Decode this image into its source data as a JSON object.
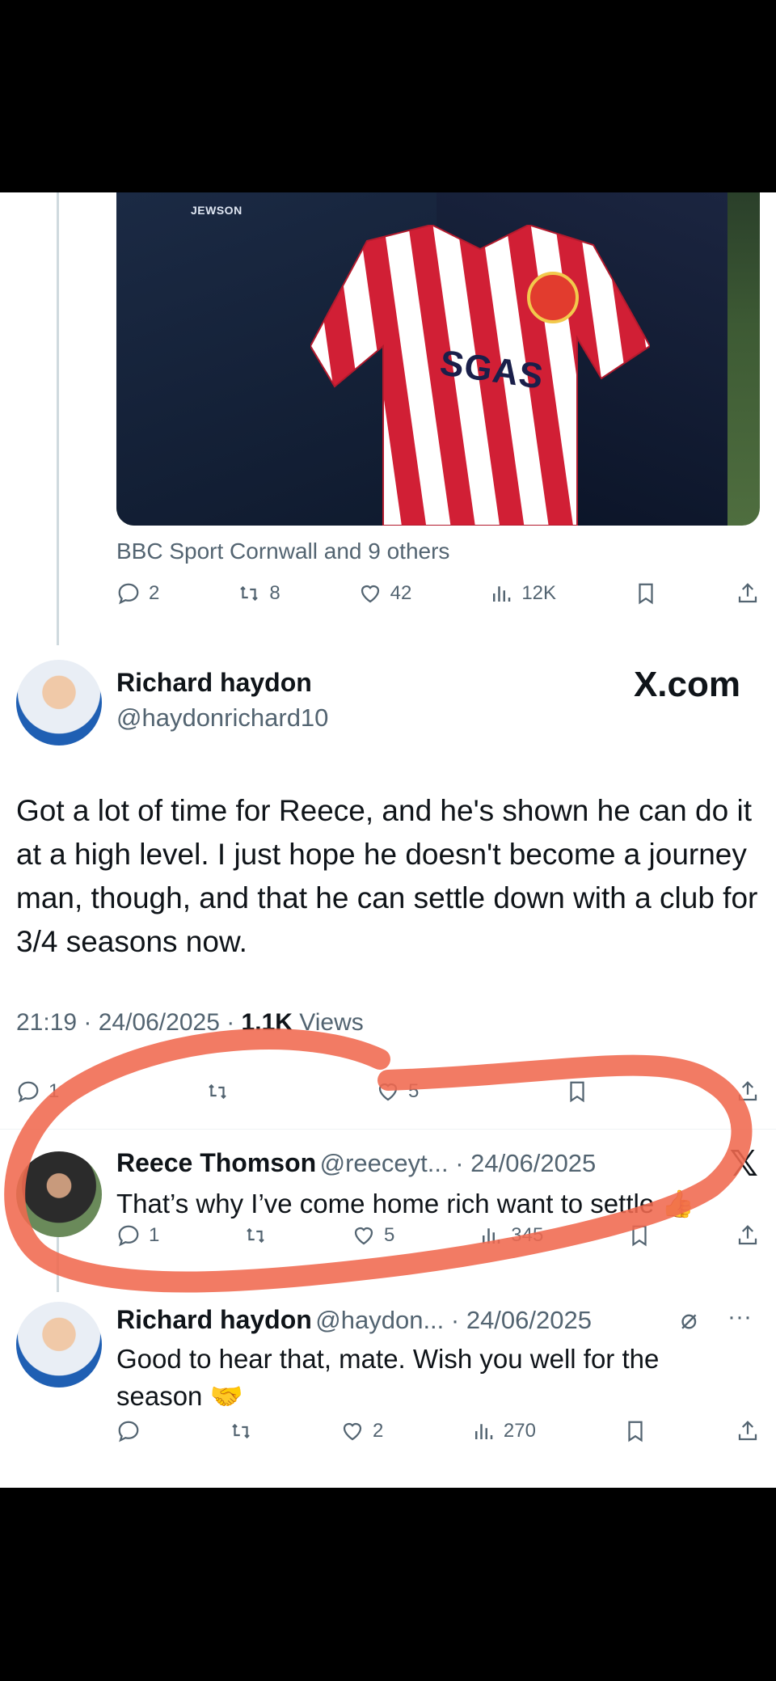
{
  "original_post": {
    "liked_by": "BBC Sport Cornwall and 9 others",
    "media_sponsor_text": "SGAS",
    "media_kit_text": "JEWSON",
    "stats": {
      "replies": "2",
      "reposts": "8",
      "likes": "42",
      "views": "12K"
    }
  },
  "focused_post": {
    "name": "Richard haydon",
    "handle": "@haydonrichard10",
    "source_badge": "X.com",
    "text": "Got a lot of time for Reece, and he's shown he can do it at a high level. I just hope he doesn't become a journey man, though, and that he can settle down with a club for 3/4 seasons now.",
    "time": "21:19 · 24/06/2025 · ",
    "views_count": "1.1K",
    "views_label": " Views",
    "stats": {
      "replies": "1",
      "likes": "5"
    }
  },
  "reply1": {
    "name": "Reece Thomson",
    "handle": "@reeceyt... · 24/06/2025",
    "text": "That’s why I’ve come home rich want to settle 👍",
    "stats": {
      "replies": "1",
      "likes": "5",
      "views": "345"
    }
  },
  "reply2": {
    "name": "Richard haydon",
    "handle": "@haydon... · 24/06/2025",
    "text": "Good to hear that, mate. Wish you well for the season 🤝",
    "more": "···",
    "stats": {
      "likes": "2",
      "views": "270"
    }
  },
  "colors": {
    "annotation": "#f0694f",
    "secondary_text": "#536471",
    "primary_text": "#0f1419"
  }
}
